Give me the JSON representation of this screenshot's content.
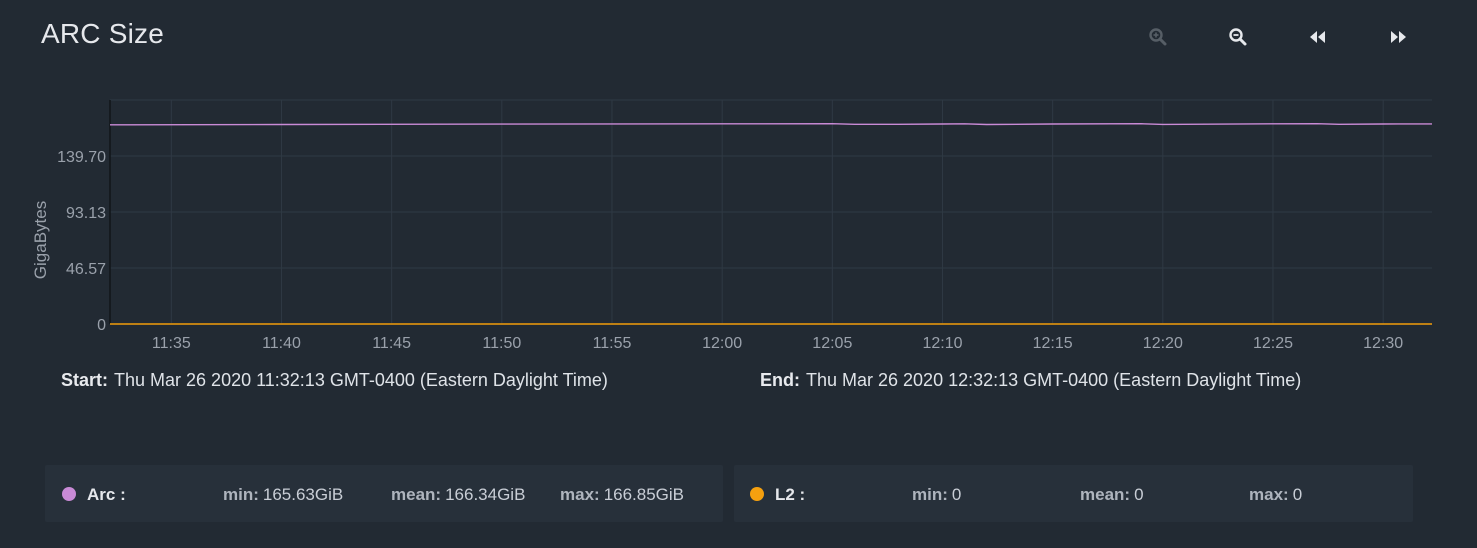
{
  "card": {
    "title": "ARC Size"
  },
  "toolbar": {
    "buttons": [
      {
        "name": "zoom-in-button",
        "icon": "zoom-in-icon",
        "disabled": true
      },
      {
        "name": "zoom-out-button",
        "icon": "zoom-out-icon",
        "disabled": false
      },
      {
        "name": "step-back-button",
        "icon": "rewind-icon",
        "disabled": false
      },
      {
        "name": "step-forward-button",
        "icon": "fast-forward-icon",
        "disabled": false
      }
    ]
  },
  "range": {
    "start_label": "Start:",
    "start_value": "Thu Mar 26 2020 11:32:13 GMT-0400 (Eastern Daylight Time)",
    "end_label": "End:",
    "end_value": "Thu Mar 26 2020 12:32:13 GMT-0400 (Eastern Daylight Time)"
  },
  "legend": [
    {
      "name": "Arc :",
      "color": "#c98ad6",
      "min_label": "min:",
      "min": "165.63GiB",
      "mean_label": "mean:",
      "mean": "166.34GiB",
      "max_label": "max:",
      "max": "166.85GiB"
    },
    {
      "name": "L2 :",
      "color": "#f5a00f",
      "min_label": "min:",
      "min": "0",
      "mean_label": "mean:",
      "mean": "0",
      "max_label": "max:",
      "max": "0"
    }
  ],
  "chart_data": {
    "type": "line",
    "ylabel": "GigaBytes",
    "xlabel": "",
    "ylim": [
      0,
      186.27
    ],
    "yticks": [
      "0",
      "46.57",
      "93.13",
      "139.70"
    ],
    "xlim": [
      "11:32:13",
      "12:32:13"
    ],
    "xticks": [
      "11:35",
      "11:40",
      "11:45",
      "11:50",
      "11:55",
      "12:00",
      "12:05",
      "12:10",
      "12:15",
      "12:20",
      "12:25",
      "12:30"
    ],
    "grid": true,
    "series": [
      {
        "name": "Arc",
        "color": "#c98ad6",
        "x": [
          "11:32:13",
          "11:40",
          "11:50",
          "12:00",
          "12:05",
          "12:06",
          "12:08",
          "12:10",
          "12:11",
          "12:12",
          "12:15",
          "12:19",
          "12:20",
          "12:25",
          "12:27",
          "12:28",
          "12:30",
          "12:32:13"
        ],
        "values": [
          165.63,
          165.9,
          166.2,
          166.5,
          166.6,
          166.1,
          166.1,
          166.3,
          166.5,
          165.9,
          166.3,
          166.6,
          166.0,
          166.5,
          166.6,
          166.1,
          166.3,
          166.4
        ]
      },
      {
        "name": "L2",
        "color": "#f5a00f",
        "x": [
          "11:32:13",
          "12:32:13"
        ],
        "values": [
          0,
          0
        ]
      }
    ]
  }
}
